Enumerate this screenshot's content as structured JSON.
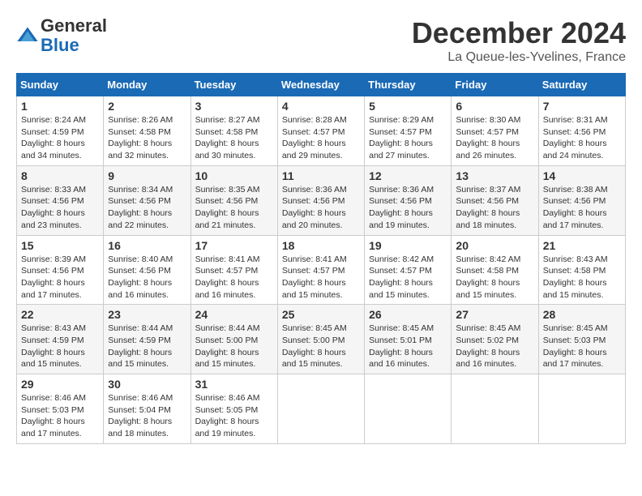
{
  "header": {
    "logo_line1": "General",
    "logo_line2": "Blue",
    "month_title": "December 2024",
    "location": "La Queue-les-Yvelines, France"
  },
  "days_of_week": [
    "Sunday",
    "Monday",
    "Tuesday",
    "Wednesday",
    "Thursday",
    "Friday",
    "Saturday"
  ],
  "weeks": [
    [
      {
        "day": "1",
        "sunrise": "8:24 AM",
        "sunset": "4:59 PM",
        "daylight": "8 hours and 34 minutes."
      },
      {
        "day": "2",
        "sunrise": "8:26 AM",
        "sunset": "4:58 PM",
        "daylight": "8 hours and 32 minutes."
      },
      {
        "day": "3",
        "sunrise": "8:27 AM",
        "sunset": "4:58 PM",
        "daylight": "8 hours and 30 minutes."
      },
      {
        "day": "4",
        "sunrise": "8:28 AM",
        "sunset": "4:57 PM",
        "daylight": "8 hours and 29 minutes."
      },
      {
        "day": "5",
        "sunrise": "8:29 AM",
        "sunset": "4:57 PM",
        "daylight": "8 hours and 27 minutes."
      },
      {
        "day": "6",
        "sunrise": "8:30 AM",
        "sunset": "4:57 PM",
        "daylight": "8 hours and 26 minutes."
      },
      {
        "day": "7",
        "sunrise": "8:31 AM",
        "sunset": "4:56 PM",
        "daylight": "8 hours and 24 minutes."
      }
    ],
    [
      {
        "day": "8",
        "sunrise": "8:33 AM",
        "sunset": "4:56 PM",
        "daylight": "8 hours and 23 minutes."
      },
      {
        "day": "9",
        "sunrise": "8:34 AM",
        "sunset": "4:56 PM",
        "daylight": "8 hours and 22 minutes."
      },
      {
        "day": "10",
        "sunrise": "8:35 AM",
        "sunset": "4:56 PM",
        "daylight": "8 hours and 21 minutes."
      },
      {
        "day": "11",
        "sunrise": "8:36 AM",
        "sunset": "4:56 PM",
        "daylight": "8 hours and 20 minutes."
      },
      {
        "day": "12",
        "sunrise": "8:36 AM",
        "sunset": "4:56 PM",
        "daylight": "8 hours and 19 minutes."
      },
      {
        "day": "13",
        "sunrise": "8:37 AM",
        "sunset": "4:56 PM",
        "daylight": "8 hours and 18 minutes."
      },
      {
        "day": "14",
        "sunrise": "8:38 AM",
        "sunset": "4:56 PM",
        "daylight": "8 hours and 17 minutes."
      }
    ],
    [
      {
        "day": "15",
        "sunrise": "8:39 AM",
        "sunset": "4:56 PM",
        "daylight": "8 hours and 17 minutes."
      },
      {
        "day": "16",
        "sunrise": "8:40 AM",
        "sunset": "4:56 PM",
        "daylight": "8 hours and 16 minutes."
      },
      {
        "day": "17",
        "sunrise": "8:41 AM",
        "sunset": "4:57 PM",
        "daylight": "8 hours and 16 minutes."
      },
      {
        "day": "18",
        "sunrise": "8:41 AM",
        "sunset": "4:57 PM",
        "daylight": "8 hours and 15 minutes."
      },
      {
        "day": "19",
        "sunrise": "8:42 AM",
        "sunset": "4:57 PM",
        "daylight": "8 hours and 15 minutes."
      },
      {
        "day": "20",
        "sunrise": "8:42 AM",
        "sunset": "4:58 PM",
        "daylight": "8 hours and 15 minutes."
      },
      {
        "day": "21",
        "sunrise": "8:43 AM",
        "sunset": "4:58 PM",
        "daylight": "8 hours and 15 minutes."
      }
    ],
    [
      {
        "day": "22",
        "sunrise": "8:43 AM",
        "sunset": "4:59 PM",
        "daylight": "8 hours and 15 minutes."
      },
      {
        "day": "23",
        "sunrise": "8:44 AM",
        "sunset": "4:59 PM",
        "daylight": "8 hours and 15 minutes."
      },
      {
        "day": "24",
        "sunrise": "8:44 AM",
        "sunset": "5:00 PM",
        "daylight": "8 hours and 15 minutes."
      },
      {
        "day": "25",
        "sunrise": "8:45 AM",
        "sunset": "5:00 PM",
        "daylight": "8 hours and 15 minutes."
      },
      {
        "day": "26",
        "sunrise": "8:45 AM",
        "sunset": "5:01 PM",
        "daylight": "8 hours and 16 minutes."
      },
      {
        "day": "27",
        "sunrise": "8:45 AM",
        "sunset": "5:02 PM",
        "daylight": "8 hours and 16 minutes."
      },
      {
        "day": "28",
        "sunrise": "8:45 AM",
        "sunset": "5:03 PM",
        "daylight": "8 hours and 17 minutes."
      }
    ],
    [
      {
        "day": "29",
        "sunrise": "8:46 AM",
        "sunset": "5:03 PM",
        "daylight": "8 hours and 17 minutes."
      },
      {
        "day": "30",
        "sunrise": "8:46 AM",
        "sunset": "5:04 PM",
        "daylight": "8 hours and 18 minutes."
      },
      {
        "day": "31",
        "sunrise": "8:46 AM",
        "sunset": "5:05 PM",
        "daylight": "8 hours and 19 minutes."
      },
      null,
      null,
      null,
      null
    ]
  ]
}
